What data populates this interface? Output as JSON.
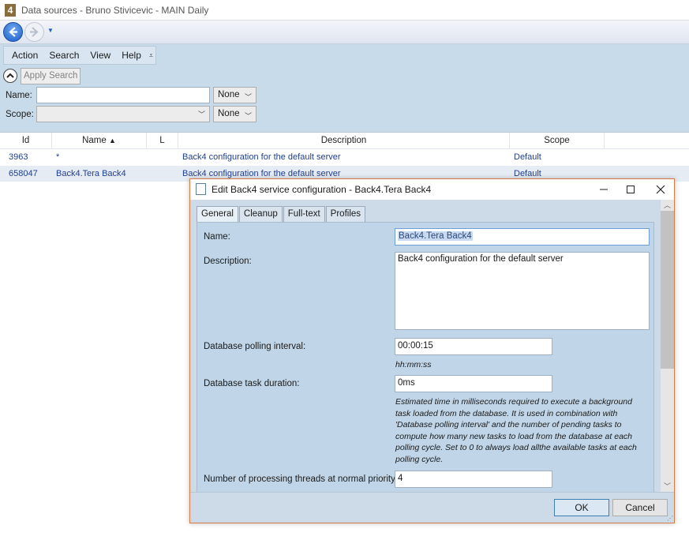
{
  "window": {
    "title": "Data sources - Bruno Stivicevic - MAIN Daily",
    "logo_text": "4"
  },
  "menu": {
    "items": [
      "Action",
      "Search",
      "View",
      "Help"
    ]
  },
  "toolbar": {
    "apply_search": "Apply Search"
  },
  "filters": {
    "name_label": "Name:",
    "name_value": "",
    "name_mode": "None",
    "scope_label": "Scope:",
    "scope_value": "",
    "scope_mode": "None"
  },
  "grid": {
    "columns": [
      "Id",
      "Name",
      "L",
      "Description",
      "Scope"
    ],
    "sort_column": "Name",
    "sort_direction": "ascending",
    "rows": [
      {
        "id": "3963",
        "name": "*",
        "l": "",
        "description": "Back4 configuration for the default server",
        "scope": "Default"
      },
      {
        "id": "658047",
        "name": "Back4.Tera Back4",
        "l": "",
        "description": "Back4 configuration for the default server",
        "scope": "Default"
      }
    ]
  },
  "dialog": {
    "title": "Edit Back4 service configuration - Back4.Tera Back4",
    "tabs": [
      "General",
      "Cleanup",
      "Full-text",
      "Profiles"
    ],
    "active_tab": "General",
    "fields": {
      "name_label": "Name:",
      "name_value": "Back4.Tera Back4",
      "description_label": "Description:",
      "description_value": "Back4 configuration for the default server",
      "polling_label": "Database polling interval:",
      "polling_value": "00:00:15",
      "polling_hint": "hh:mm:ss",
      "duration_label": "Database task duration:",
      "duration_value": "0ms",
      "duration_hint": "Estimated time in milliseconds required to execute a background task loaded from the database. It is used in combination with 'Database polling interval' and the number of pending tasks to compute how many new tasks to load from the database at each polling cycle. Set to 0 to always load allthe available tasks at each polling cycle.",
      "threads_label": "Number of processing threads at normal priority:",
      "threads_value": "4"
    },
    "ok_label": "OK",
    "cancel_label": "Cancel"
  },
  "colors": {
    "toolbar_bg": "#c7dbea",
    "dialog_border": "#d77b47",
    "link_text": "#1f3f8f",
    "panel_bg": "#c0d6e8"
  }
}
